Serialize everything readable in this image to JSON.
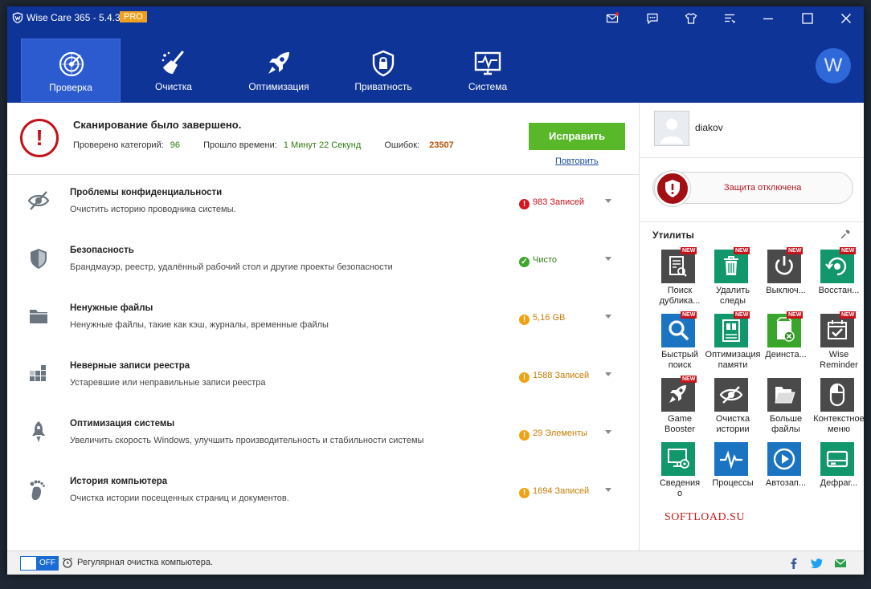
{
  "app": {
    "title": "Wise Care 365 - 5.4.3",
    "badge": "PRO",
    "avatar_letter": "W"
  },
  "nav": {
    "tabs": [
      {
        "label": "Проверка",
        "icon": "radar-icon"
      },
      {
        "label": "Очистка",
        "icon": "broom-icon"
      },
      {
        "label": "Оптимизация",
        "icon": "rocket-icon"
      },
      {
        "label": "Приватность",
        "icon": "lock-shield-icon"
      },
      {
        "label": "Система",
        "icon": "monitor-pulse-icon"
      }
    ]
  },
  "scan": {
    "title": "Сканирование было завершено.",
    "checked_label": "Проверено категорий:",
    "checked_value": "96",
    "time_label": "Прошло времени:",
    "time_value": "1 Минут 22 Секунд",
    "errors_label": "Ошибок:",
    "errors_value": "23507",
    "fix_button": "Исправить",
    "retry_link": "Повторить"
  },
  "categories": [
    {
      "title": "Проблемы конфиденциальности",
      "desc": "Очистить историю проводника системы.",
      "status": "983 Записей",
      "level": "error",
      "icon": "eye-slash-icon"
    },
    {
      "title": "Безопасность",
      "desc": "Брандмауэр, реестр, удалённый рабочий стол и другие проекты безопасности",
      "status": "Чисто",
      "level": "ok",
      "icon": "shield-icon"
    },
    {
      "title": "Ненужные файлы",
      "desc": "Ненужные файлы, такие как кэш, журналы, временные файлы",
      "status": "5,16 GB",
      "level": "warn",
      "icon": "folder-icon"
    },
    {
      "title": "Неверные записи реестра",
      "desc": "Устаревшие или неправильные записи реестра",
      "status": "1588 Записей",
      "level": "warn",
      "icon": "registry-blocks-icon"
    },
    {
      "title": "Оптимизация системы",
      "desc": "Увеличить скорость Windows, улучшить производительность и стабильности системы",
      "status": "29 Элементы",
      "level": "warn",
      "icon": "rocket-icon"
    },
    {
      "title": "История компьютера",
      "desc": "Очистка истории посещенных страниц и документов.",
      "status": "1694 Записей",
      "level": "warn",
      "icon": "footprint-icon"
    }
  ],
  "colors": {
    "error": "#d8151d",
    "ok": "#3ea52d",
    "warn": "#f0a312",
    "error_text": "#c4111a",
    "ok_text": "#2f7d13",
    "warn_text": "#c77b05"
  },
  "user": {
    "name": "diakov"
  },
  "protection": {
    "label": "Защита отключена"
  },
  "utilities": {
    "heading": "Утилиты",
    "new_badge": "NEW",
    "items": [
      {
        "label": "Поиск дублика...",
        "color": "#4a4a4a",
        "icon": "duplicate-search-icon",
        "new": true
      },
      {
        "label": "Удалить следы",
        "color": "#12966b",
        "icon": "trash-icon",
        "new": true
      },
      {
        "label": "Выключ...",
        "color": "#4a4a4a",
        "icon": "power-icon",
        "new": true
      },
      {
        "label": "Восстан...",
        "color": "#12966b",
        "icon": "restore-icon",
        "new": true
      },
      {
        "label": "Быстрый поиск",
        "color": "#1b74c2",
        "icon": "magnifier-icon",
        "new": true
      },
      {
        "label": "Оптимизация памяти",
        "color": "#12966b",
        "icon": "memory-icon",
        "new": true
      },
      {
        "label": "Деинста...",
        "color": "#3aa52b",
        "icon": "uninstall-icon",
        "new": true
      },
      {
        "label": "Wise Reminder",
        "color": "#4a4a4a",
        "icon": "calendar-check-icon",
        "new": true
      },
      {
        "label": "Game Booster",
        "color": "#4a4a4a",
        "icon": "rocket-icon",
        "new": true
      },
      {
        "label": "Очистка истории",
        "color": "#4a4a4a",
        "icon": "eye-slash-icon",
        "new": false
      },
      {
        "label": "Больше файлы",
        "color": "#4a4a4a",
        "icon": "folder-open-icon",
        "new": false
      },
      {
        "label": "Контекстное меню",
        "color": "#4a4a4a",
        "icon": "mouse-icon",
        "new": false
      },
      {
        "label": "Сведения о",
        "color": "#12966b",
        "icon": "computer-info-icon",
        "new": false
      },
      {
        "label": "Процессы",
        "color": "#1b74c2",
        "icon": "pulse-icon",
        "new": false
      },
      {
        "label": "Автозап...",
        "color": "#1b74c2",
        "icon": "play-icon",
        "new": false
      },
      {
        "label": "Дефраг...",
        "color": "#12966b",
        "icon": "disk-icon",
        "new": false
      }
    ]
  },
  "watermark": "SOFTLOAD.SU",
  "bottom": {
    "toggle": "OFF",
    "schedule_text": "Регулярная очистка компьютера."
  }
}
